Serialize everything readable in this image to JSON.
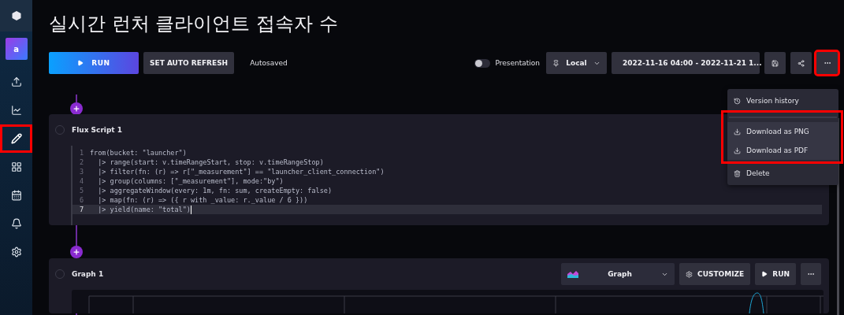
{
  "title": "실시간 런처 클라이언트 접속자 수",
  "sidebar": {
    "avatar": "a",
    "items": [
      {
        "kind": "upload",
        "selected": false,
        "highlighted": false
      },
      {
        "kind": "chart",
        "selected": false,
        "highlighted": false
      },
      {
        "kind": "pencil",
        "selected": true,
        "highlighted": true
      },
      {
        "kind": "grid",
        "selected": false,
        "highlighted": false
      },
      {
        "kind": "calendar",
        "selected": false,
        "highlighted": false
      },
      {
        "kind": "bell",
        "selected": false,
        "highlighted": false
      },
      {
        "kind": "gear",
        "selected": false,
        "highlighted": false
      }
    ]
  },
  "toolbar": {
    "run": "RUN",
    "auto_refresh": "SET AUTO REFRESH",
    "status": "Autosaved",
    "presentation": {
      "label": "Presentation",
      "on": false
    },
    "timezone": "Local",
    "range": "2022-11-16 04:00 - 2022-11-21 1...",
    "more_highlighted": true
  },
  "menu": {
    "items": [
      {
        "kind": "history",
        "label": "Version history",
        "highlighted": false
      },
      {
        "kind": "download",
        "label": "Download as PNG",
        "highlighted": true
      },
      {
        "kind": "download",
        "label": "Download as PDF",
        "highlighted": true
      },
      {
        "kind": "trash",
        "label": "Delete",
        "highlighted": false
      }
    ]
  },
  "script_panel": {
    "title": "Flux Script 1",
    "lines": [
      {
        "number": "1",
        "code": "from(bucket: \"launcher\")",
        "active": false
      },
      {
        "number": "2",
        "code": "  |> range(start: v.timeRangeStart, stop: v.timeRangeStop)",
        "active": false
      },
      {
        "number": "3",
        "code": "  |> filter(fn: (r) => r[\"_measurement\"] == \"launcher_client_connection\")",
        "active": false
      },
      {
        "number": "4",
        "code": "  |> group(columns: [\"_measurement\"], mode:\"by\")",
        "active": false
      },
      {
        "number": "5",
        "code": "  |> aggregateWindow(every: 1m, fn: sum, createEmpty: false)",
        "active": false
      },
      {
        "number": "6",
        "code": "  |> map(fn: (r) => ({ r with _value: r._value / 6 }))",
        "active": false
      },
      {
        "number": "7",
        "code": "  |> yield(name: \"total\")",
        "active": true
      }
    ]
  },
  "graph_panel": {
    "title": "Graph 1",
    "view": "Graph",
    "customize": "CUSTOMIZE",
    "run": "RUN"
  }
}
